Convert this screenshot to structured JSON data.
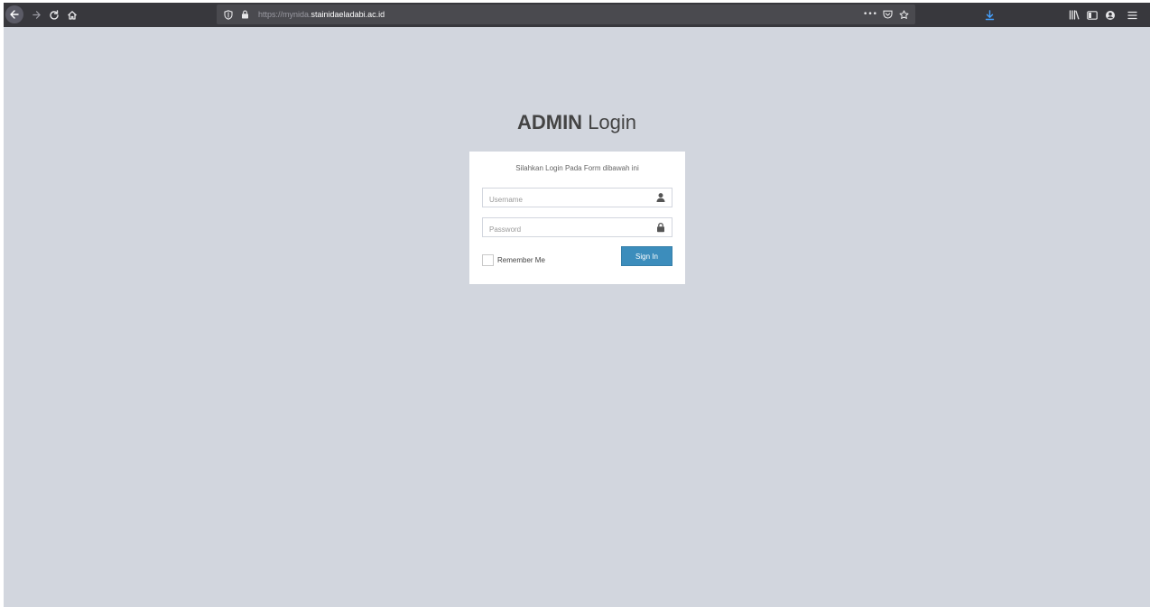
{
  "browser": {
    "url_scheme": "https://mynida.",
    "url_host": "stainidaeladabi.ac.id",
    "page_actions_label": "•••",
    "colors": {
      "toolbar_bg": "#38383d",
      "download_icon": "#45a1ff"
    },
    "icons": [
      "back-icon",
      "forward-icon",
      "reload-icon",
      "home-icon",
      "tracking-shield-icon",
      "lock-icon",
      "page-actions-icon",
      "pocket-icon",
      "bookmark-star-icon",
      "download-icon",
      "library-icon",
      "sidebar-icon",
      "account-icon",
      "menu-icon"
    ]
  },
  "page": {
    "title_bold": "ADMIN",
    "title_light": " Login",
    "message": "Silahkan Login Pada Form dibawah ini",
    "username": {
      "placeholder": "Username",
      "value": ""
    },
    "password": {
      "placeholder": "Password",
      "value": ""
    },
    "remember_label": "Remember Me",
    "remember_checked": false,
    "signin_label": "Sign In",
    "colors": {
      "background": "#d2d6de",
      "primary_button": "#3c8dbc"
    }
  }
}
